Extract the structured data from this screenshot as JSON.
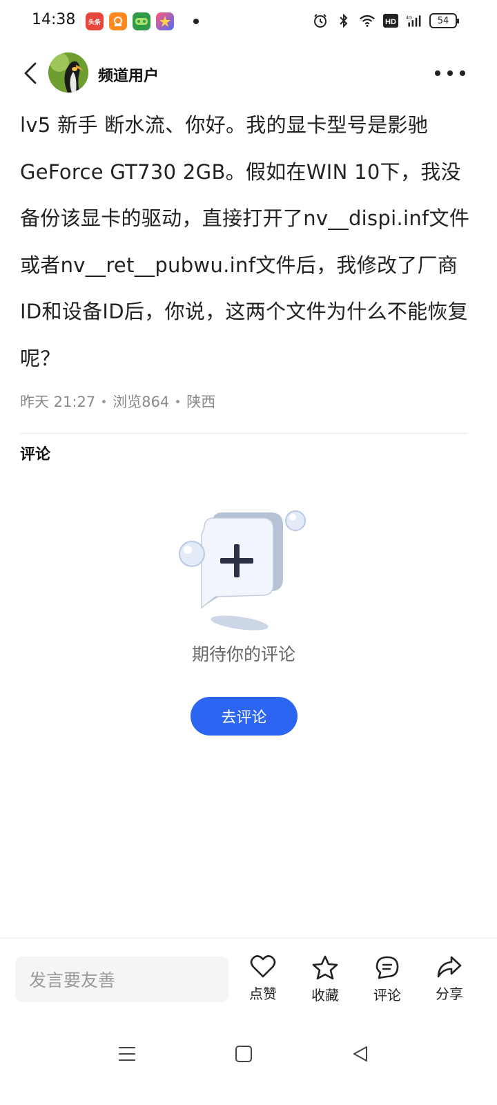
{
  "status_bar": {
    "time": "14:38",
    "app_icons": [
      {
        "name": "toutiao-app-icon",
        "label": "头条",
        "color": "#e8453c"
      },
      {
        "name": "store-app-icon",
        "label": "",
        "color": "#ff8a1f"
      },
      {
        "name": "game-app-icon",
        "label": "",
        "color": "#2f9a47"
      },
      {
        "name": "star-app-icon",
        "label": "",
        "color": "#4e6cf2"
      }
    ],
    "battery_level": "54"
  },
  "header": {
    "user_name": "频道用户"
  },
  "post": {
    "body": "lv5  新手  断水流、你好。我的显卡型号是影驰GeForce GT730 2GB。假如在WIN 10下，我没备份该显卡的驱动，直接打开了nv__dispi.inf文件或者nv__ret__pubwu.inf文件后，我修改了厂商ID和设备ID后，你说，这两个文件为什么不能恢复呢？",
    "date": "昨天  21:27",
    "views": "浏览864",
    "location": "陕西"
  },
  "comments": {
    "title": "评论",
    "empty_text": "期待你的评论",
    "go_comment_label": "去评论"
  },
  "bottom_bar": {
    "input_placeholder": "发言要友善",
    "like_label": "点赞",
    "favorite_label": "收藏",
    "comment_label": "评论",
    "share_label": "分享"
  },
  "colors": {
    "accent": "#2d65f3",
    "meta_text": "#8a8a8a"
  }
}
